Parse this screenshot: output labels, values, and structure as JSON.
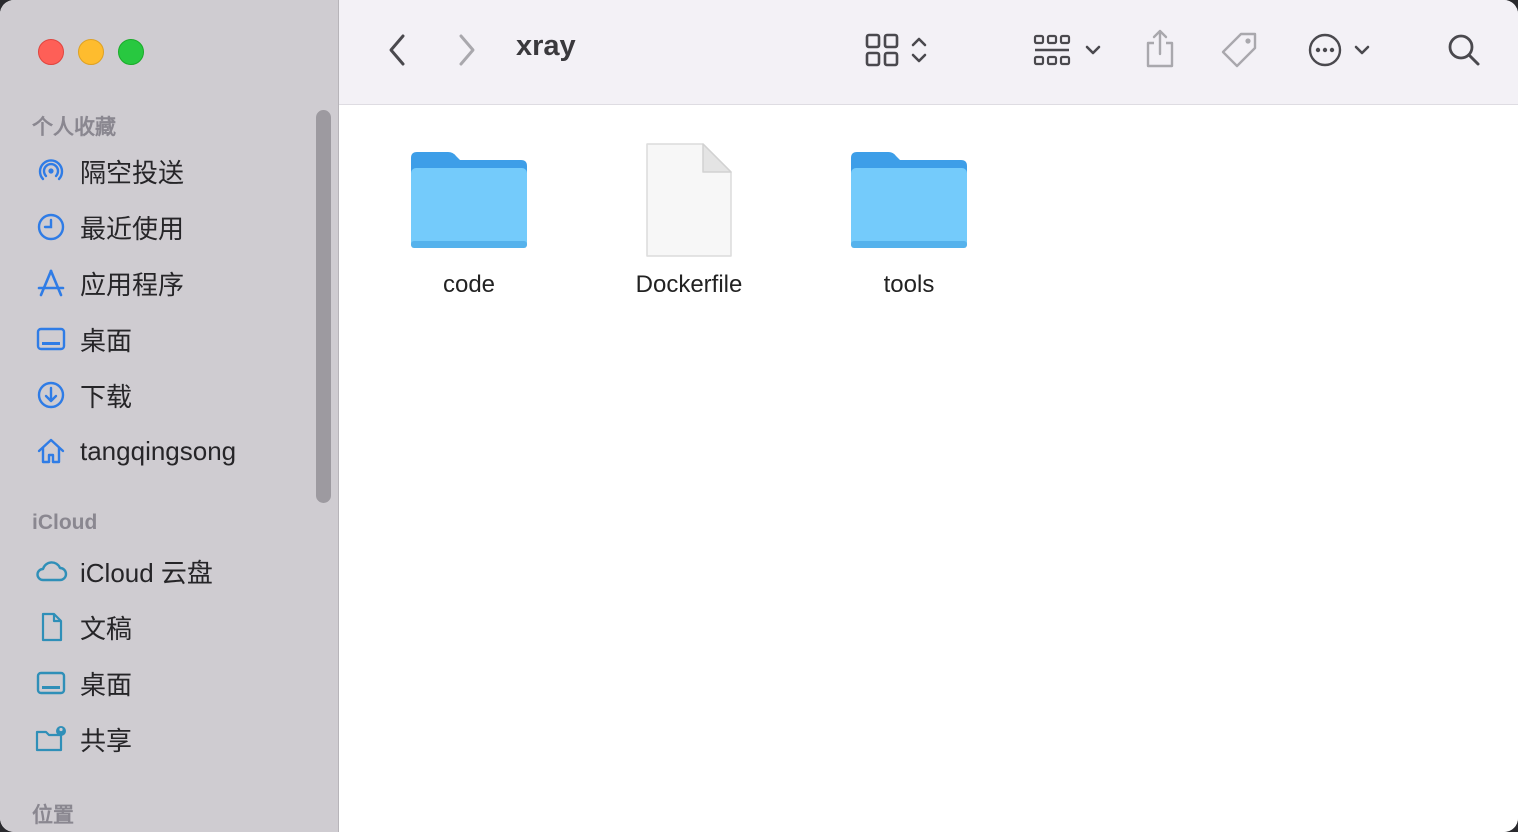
{
  "window": {
    "title": "xray"
  },
  "sidebar": {
    "favorites_title": "个人收藏",
    "favorites": [
      {
        "label": "隔空投送",
        "icon": "airdrop-icon"
      },
      {
        "label": "最近使用",
        "icon": "clock-icon"
      },
      {
        "label": "应用程序",
        "icon": "applications-icon"
      },
      {
        "label": "桌面",
        "icon": "desktop-icon"
      },
      {
        "label": "下载",
        "icon": "download-icon"
      },
      {
        "label": "tangqingsong",
        "icon": "home-icon"
      }
    ],
    "icloud_title": "iCloud",
    "icloud": [
      {
        "label": "iCloud 云盘",
        "icon": "cloud-icon"
      },
      {
        "label": "文稿",
        "icon": "document-icon"
      },
      {
        "label": "桌面",
        "icon": "desktop-icon"
      },
      {
        "label": "共享",
        "icon": "shared-folder-icon"
      }
    ],
    "locations_title": "位置"
  },
  "files": [
    {
      "name": "code",
      "kind": "folder"
    },
    {
      "name": "Dockerfile",
      "kind": "file"
    },
    {
      "name": "tools",
      "kind": "folder"
    }
  ],
  "colors": {
    "sidebar_bg": "#cfccd1",
    "accent_blue": "#2f7ce6",
    "folder_blue": "#6ec6f7"
  }
}
